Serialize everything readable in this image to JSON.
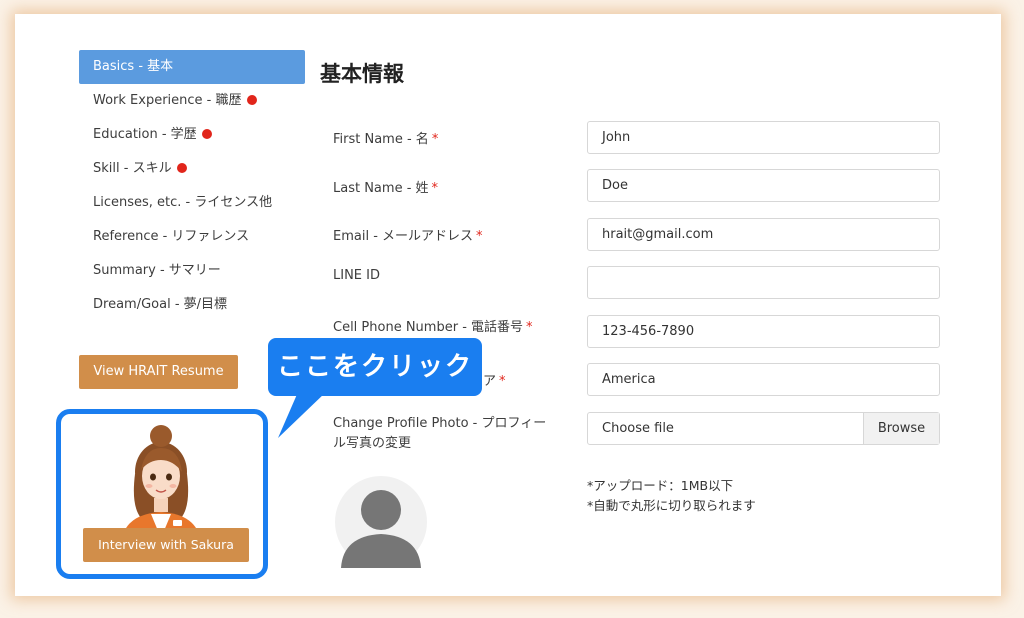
{
  "sidebar": {
    "items": [
      {
        "label": "Basics - 基本",
        "active": true,
        "alert": false
      },
      {
        "label": "Work Experience - 職歴",
        "active": false,
        "alert": true
      },
      {
        "label": "Education - 学歴",
        "active": false,
        "alert": true
      },
      {
        "label": "Skill - スキル",
        "active": false,
        "alert": true
      },
      {
        "label": "Licenses, etc. - ライセンス他",
        "active": false,
        "alert": false
      },
      {
        "label": "Reference - リファレンス",
        "active": false,
        "alert": false
      },
      {
        "label": "Summary - サマリー",
        "active": false,
        "alert": false
      },
      {
        "label": "Dream/Goal - 夢/目標",
        "active": false,
        "alert": false
      }
    ],
    "view_resume_label": "View HRAIT Resume",
    "interview_label": "Interview with Sakura"
  },
  "callout": {
    "text": "ここをクリック"
  },
  "form": {
    "title": "基本情報",
    "fields": [
      {
        "label": "First Name - 名",
        "value": "John",
        "required": true
      },
      {
        "label": "Last Name - 姓",
        "value": "Doe",
        "required": true
      },
      {
        "label": "Email - メールアドレス",
        "value": "hrait@gmail.com",
        "required": true
      },
      {
        "label": "LINE ID",
        "value": "",
        "required": false
      },
      {
        "label": "Cell Phone Number - 電話番号",
        "value": "123-456-7890",
        "required": true
      },
      {
        "label": "ア",
        "value": "America",
        "required": true
      }
    ],
    "photo": {
      "label_line1": "Change Profile Photo - プロフィー",
      "label_line2": "ル写真の変更",
      "file_text": "Choose file",
      "browse_label": "Browse"
    },
    "notes": [
      "*アップロード：1MB以下",
      "*自動で丸形に切り取られます"
    ]
  },
  "colors": {
    "accent_blue": "#1a7ef0",
    "active_item": "#5b9bdf",
    "button_orange": "#d18e4a",
    "alert_red": "#e1251b"
  }
}
